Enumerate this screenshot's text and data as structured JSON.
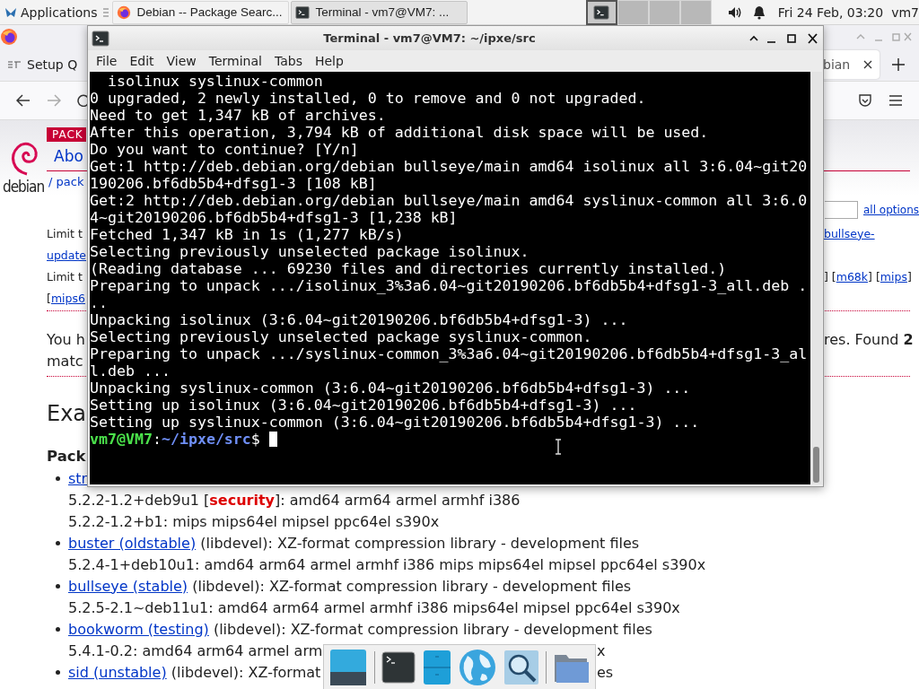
{
  "top_panel": {
    "applications": "Applications",
    "tasks": [
      {
        "title": "Debian -- Package Searc...",
        "kind": "browser",
        "selected": false
      },
      {
        "title": "Terminal - vm7@VM7: ...",
        "kind": "terminal",
        "selected": true
      }
    ],
    "workspaces": [
      {
        "selected": true
      },
      {
        "selected": false
      },
      {
        "selected": false
      },
      {
        "selected": false
      }
    ],
    "clock": "Fri 24 Feb, 03:20",
    "user": "vm7"
  },
  "browser": {
    "tabs": [
      {
        "title": "Setup Q",
        "selected": false
      },
      {
        "title": "bian",
        "selected": true
      }
    ],
    "page": {
      "banner": "PACK",
      "logo_text": "debian",
      "nav_tab": "Abo",
      "breadcrumb": "/ pack",
      "options_link": "all options",
      "filter_rows": [
        {
          "left": [
            {
              "text": "Limit t",
              "link": false
            }
          ],
          "right": [
            {
              "text": "bullseye-",
              "link": true
            }
          ]
        },
        {
          "left": [
            {
              "text": "update",
              "link": true
            }
          ],
          "right": []
        },
        {
          "left": [
            {
              "text": "Limit t",
              "link": false
            }
          ],
          "right": [
            {
              "text": "] [",
              "link": false
            },
            {
              "text": "m68k",
              "link": true
            },
            {
              "text": "] [",
              "link": false
            },
            {
              "text": "mips",
              "link": true
            },
            {
              "text": "]",
              "link": false
            }
          ]
        },
        {
          "left": [
            {
              "text": "[",
              "link": false
            },
            {
              "text": "mips6",
              "link": true
            }
          ],
          "right": []
        }
      ],
      "intro": {
        "lines": [
          "You h",
          "matc"
        ],
        "right": "res. Found **2**"
      },
      "heading": "Exa",
      "subheading": "Pack",
      "packages": [
        {
          "link": "str",
          "versions": [
            {
              "text": "5.2.2-1.2+deb9u1 [**security**]: amd64 arm64 armel armhf i386"
            },
            {
              "text": "5.2.2-1.2+b1: mips mips64el mipsel ppc64el s390x"
            }
          ]
        },
        {
          "link": "buster (oldstable)",
          "description": "(libdevel): XZ-format compression library - development files",
          "versions": [
            {
              "text": "5.2.4-1+deb10u1: amd64 arm64 armel armhf i386 mips mips64el mipsel ppc64el s390x"
            }
          ]
        },
        {
          "link": "bullseye (stable)",
          "description": "(libdevel): XZ-format compression library - development files",
          "versions": [
            {
              "text": "5.2.5-2.1~deb11u1: amd64 arm64 armel armhf i386 mips64el mipsel ppc64el s390x"
            }
          ]
        },
        {
          "link": "bookworm (testing)",
          "description": "(libdevel): XZ-format compression library - development files",
          "versions": [
            {
              "text": "5.4.1-0.2: amd64 arm64 armel arm",
              "tail": "x"
            }
          ]
        },
        {
          "link": "sid (unstable)",
          "description": "(libdevel): XZ-format",
          "tail": "es"
        }
      ]
    }
  },
  "terminal": {
    "title": "Terminal - vm7@VM7: ~/ipxe/src",
    "menu": [
      "File",
      "Edit",
      "View",
      "Terminal",
      "Tabs",
      "Help"
    ],
    "lines": [
      "  isolinux syslinux-common",
      "0 upgraded, 2 newly installed, 0 to remove and 0 not upgraded.",
      "Need to get 1,347 kB of archives.",
      "After this operation, 3,794 kB of additional disk space will be used.",
      "Do you want to continue? [Y/n]",
      "Get:1 http://deb.debian.org/debian bullseye/main amd64 isolinux all 3:6.04~git20",
      "190206.bf6db5b4+dfsg1-3 [108 kB]",
      "Get:2 http://deb.debian.org/debian bullseye/main amd64 syslinux-common all 3:6.0",
      "4~git20190206.bf6db5b4+dfsg1-3 [1,238 kB]",
      "Fetched 1,347 kB in 1s (1,277 kB/s)",
      "Selecting previously unselected package isolinux.",
      "(Reading database ... 69230 files and directories currently installed.)",
      "Preparing to unpack .../isolinux_3%3a6.04~git20190206.bf6db5b4+dfsg1-3_all.deb .",
      "..",
      "Unpacking isolinux (3:6.04~git20190206.bf6db5b4+dfsg1-3) ...",
      "Selecting previously unselected package syslinux-common.",
      "Preparing to unpack .../syslinux-common_3%3a6.04~git20190206.bf6db5b4+dfsg1-3_al",
      "l.deb ...",
      "Unpacking syslinux-common (3:6.04~git20190206.bf6db5b4+dfsg1-3) ...",
      "Setting up isolinux (3:6.04~git20190206.bf6db5b4+dfsg1-3) ...",
      "Setting up syslinux-common (3:6.04~git20190206.bf6db5b4+dfsg1-3) ..."
    ],
    "prompt": {
      "user": "vm7@VM7",
      "separator": ":",
      "path": "~/ipxe/src",
      "symbol": "$"
    }
  },
  "dock": {
    "items": [
      {
        "kind": "desktop"
      },
      {
        "kind": "separator"
      },
      {
        "kind": "terminal"
      },
      {
        "kind": "archive"
      },
      {
        "kind": "globe"
      },
      {
        "kind": "search"
      },
      {
        "kind": "separator"
      },
      {
        "kind": "folder"
      }
    ]
  }
}
